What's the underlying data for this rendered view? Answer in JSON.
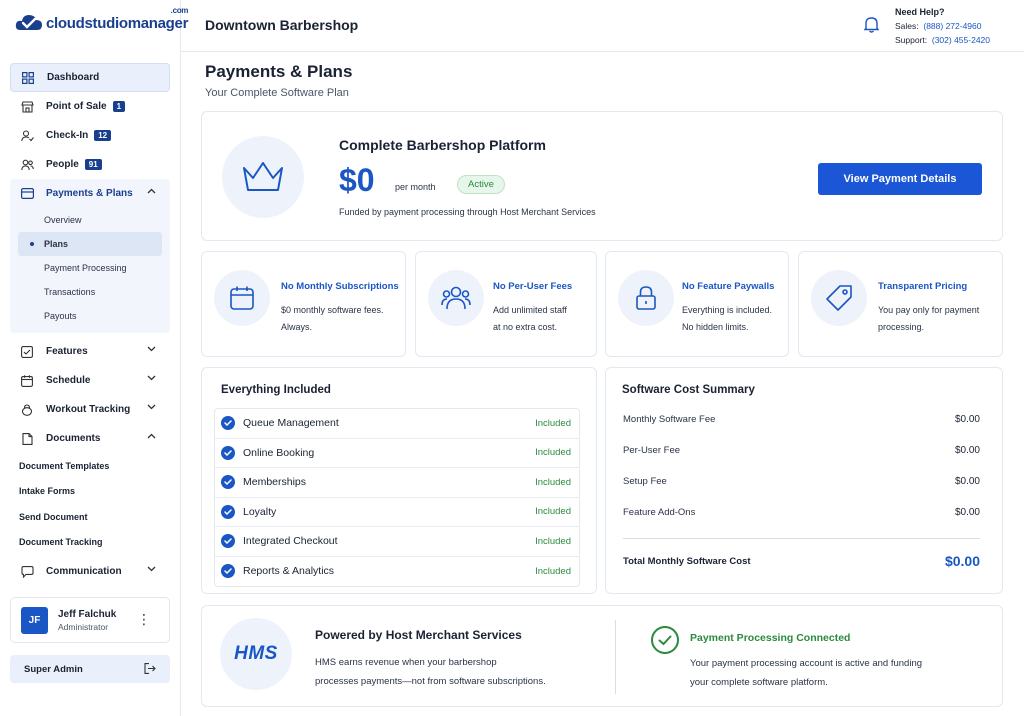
{
  "brand": {
    "logo_text": "cloudstudiomanager",
    "logo_suffix": ".com"
  },
  "header": {
    "shop_name": "Downtown Barbershop",
    "help_title": "Need Help?",
    "sales_label": "Sales:",
    "sales_phone": "(888) 272-4960",
    "support_label": "Support:",
    "support_phone": "(302) 455-2420"
  },
  "sidebar": {
    "items": [
      {
        "label": "Dashboard"
      },
      {
        "label": "Point of Sale",
        "badge": "1"
      },
      {
        "label": "Check-In",
        "badge": "12"
      },
      {
        "label": "People",
        "badge": "91"
      }
    ],
    "payments_group": {
      "label": "Payments & Plans",
      "sub_items": [
        "Overview",
        "Plans",
        "Payment Processing",
        "Transactions",
        "Payouts"
      ]
    },
    "collapsed_items": [
      "Features",
      "Schedule",
      "Workout Tracking"
    ],
    "documents_group": {
      "label": "Documents",
      "sub_items": [
        "Document Templates",
        "Intake Forms",
        "Send Document",
        "Document Tracking"
      ]
    },
    "communication_label": "Communication",
    "user": {
      "initials": "JF",
      "name": "Jeff Falchuk",
      "role": "Administrator"
    },
    "super_admin_label": "Super Admin"
  },
  "page": {
    "title": "Payments & Plans",
    "subtitle": "Your Complete Software Plan"
  },
  "plan": {
    "title": "Complete Barbershop Platform",
    "price": "$0",
    "period": "per month",
    "status": "Active",
    "funding_note": "Funded by payment processing through Host Merchant Services",
    "cta_label": "View Payment Details"
  },
  "features": [
    {
      "icon": "calendar-icon",
      "title": "No Monthly Subscriptions",
      "line1": "$0 monthly software fees.",
      "line2": "Always."
    },
    {
      "icon": "users-icon",
      "title": "No Per-User Fees",
      "line1": "Add unlimited staff",
      "line2": "at no extra cost."
    },
    {
      "icon": "lock-icon",
      "title": "No Feature Paywalls",
      "line1": "Everything is included.",
      "line2": "No hidden limits."
    },
    {
      "icon": "tag-icon",
      "title": "Transparent Pricing",
      "line1": "You pay only for payment",
      "line2": "processing."
    }
  ],
  "included": {
    "title": "Everything Included",
    "status_label": "Included",
    "items": [
      "Queue Management",
      "Online Booking",
      "Memberships",
      "Loyalty",
      "Integrated Checkout",
      "Reports & Analytics"
    ]
  },
  "summary": {
    "title": "Software Cost Summary",
    "rows": [
      {
        "label": "Monthly Software Fee",
        "value": "$0.00"
      },
      {
        "label": "Per-User Fee",
        "value": "$0.00"
      },
      {
        "label": "Setup Fee",
        "value": "$0.00"
      },
      {
        "label": "Feature Add-Ons",
        "value": "$0.00"
      }
    ],
    "total_label": "Total Monthly Software Cost",
    "total_value": "$0.00"
  },
  "powered": {
    "logo": "HMS",
    "title": "Powered by Host Merchant Services",
    "line1": "HMS earns revenue when your barbershop",
    "line2": "processes payments—not from software subscriptions.",
    "connected_title": "Payment Processing Connected",
    "connected_line1": "Your payment processing account is active and funding",
    "connected_line2": "your complete software platform."
  },
  "colors": {
    "primary": "#1a56c4",
    "brand_navy": "#1a3f8f",
    "success": "#2b8a3e"
  }
}
